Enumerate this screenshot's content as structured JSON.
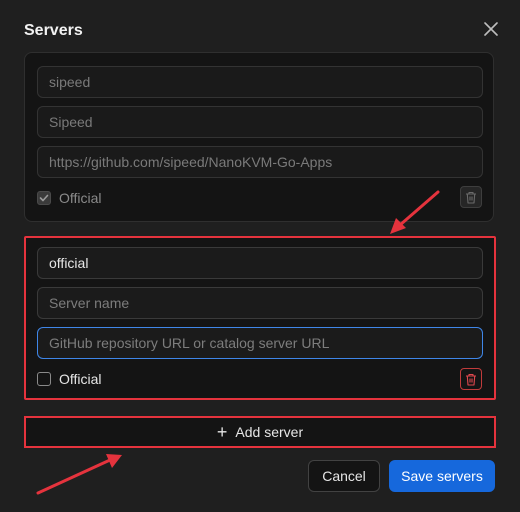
{
  "dialog": {
    "title": "Servers",
    "close_icon": "close-icon"
  },
  "servers": [
    {
      "id_value": "sipeed",
      "name_value": "Sipeed",
      "url_value": "https://github.com/sipeed/NanoKVM-Go-Apps",
      "official_label": "Official",
      "official_checked": true,
      "disabled": true
    },
    {
      "id_value": "official",
      "name_placeholder": "Server name",
      "url_placeholder": "GitHub repository URL or catalog server URL",
      "official_label": "Official",
      "official_checked": false,
      "disabled": false
    }
  ],
  "actions": {
    "add_server_label": "Add server",
    "cancel_label": "Cancel",
    "save_label": "Save servers"
  },
  "colors": {
    "accent": "#1668dc",
    "focus": "#3f86e8",
    "annotation_red": "#e5333d",
    "background": "#1f1f1f",
    "card": "#141414"
  }
}
